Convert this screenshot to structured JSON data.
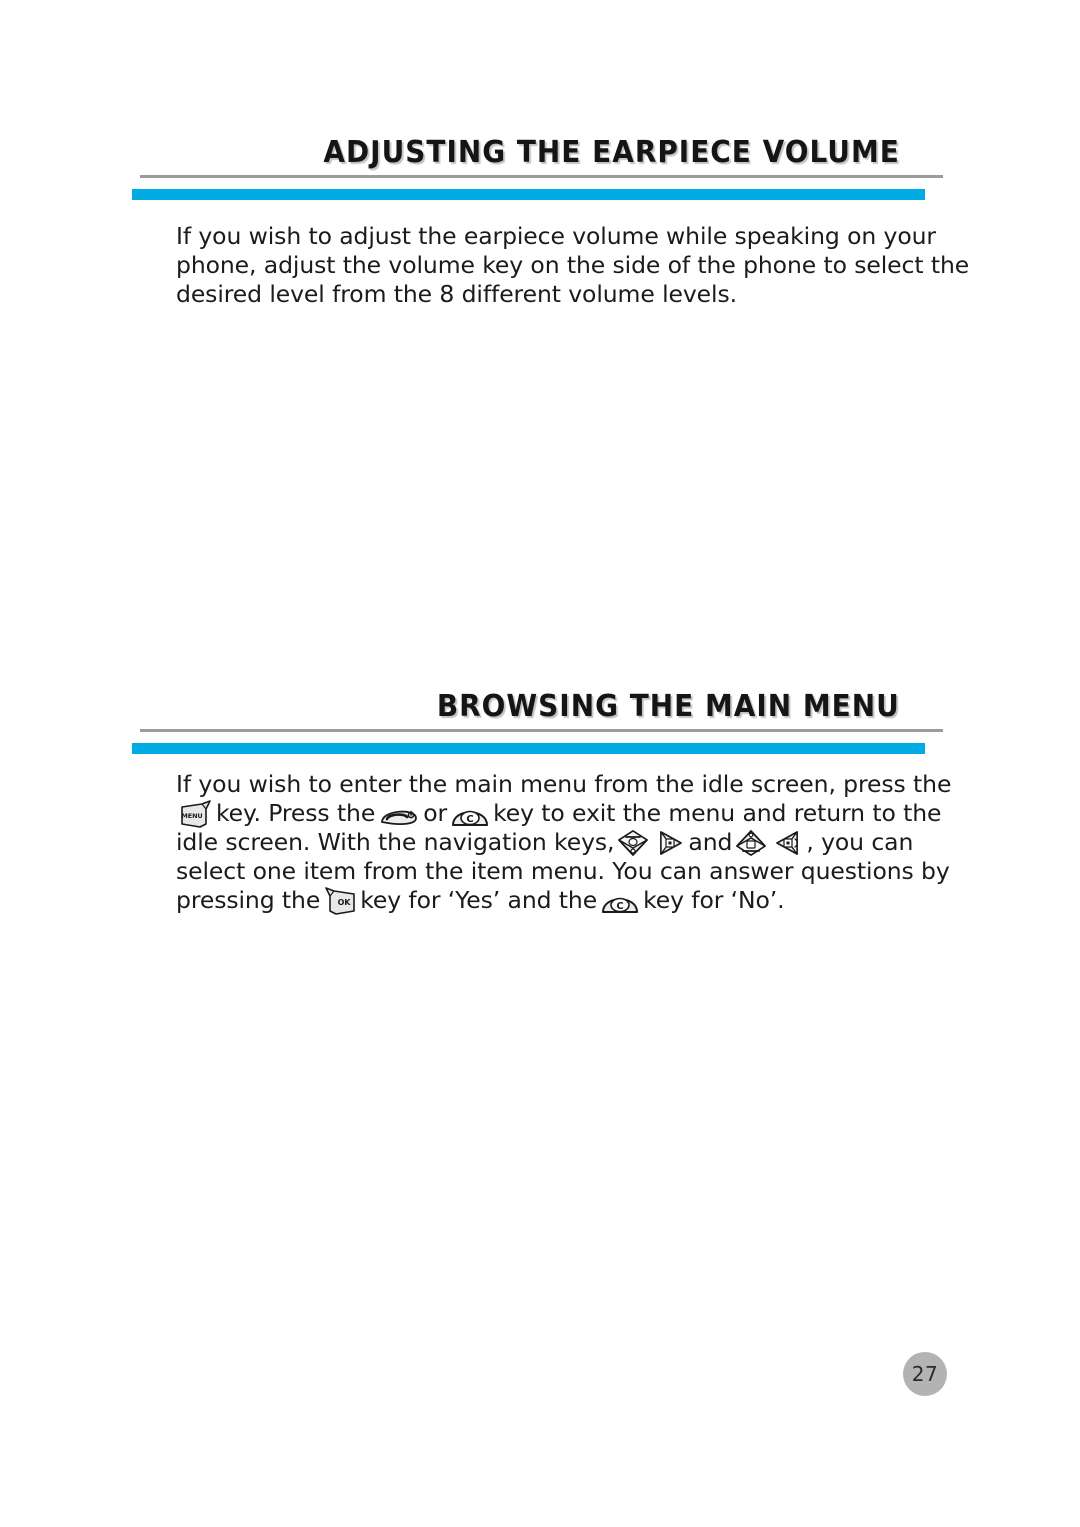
{
  "page": {
    "number": "27",
    "background_color": "#ffffff",
    "accent_color": "#00ace3",
    "rule_color": "#9b9b9b",
    "text_color": "#1b1b1b"
  },
  "sections": [
    {
      "id": "adjusting-earpiece-volume",
      "title": "ADJUSTING THE EARPIECE VOLUME",
      "lines": [
        "If you wish to adjust the earpiece volume while speaking on your",
        "phone, adjust the volume key on the side of the phone to select the",
        "desired level from the 8 different volume levels."
      ]
    },
    {
      "id": "browsing-main-menu",
      "title": "BROWSING THE MAIN MENU",
      "lines": {
        "l1": "If you wish to enter the main menu from the idle screen, press the",
        "l2a": "key. Press the",
        "l2b": "or",
        "l2c": "key to exit the menu and return to the",
        "l3a": "idle screen. With the navigation keys,",
        "l3b": "and",
        "l3c": ", you can",
        "l4": "select one item from the item menu. You can answer questions by",
        "l5a": "pressing the",
        "l5b": "key for ‘Yes’ and the",
        "l5c": "key for ‘No’."
      }
    }
  ],
  "key_icons": {
    "menu": {
      "name": "menu-key-icon",
      "label": "MENU"
    },
    "end_call": {
      "name": "end-call-key-icon",
      "label": ""
    },
    "clear": {
      "name": "clear-key-icon",
      "label": "C"
    },
    "nav_up": {
      "name": "nav-up-key-icon",
      "label": ""
    },
    "nav_right": {
      "name": "nav-right-key-icon",
      "label": ""
    },
    "nav_down": {
      "name": "nav-down-key-icon",
      "label": ""
    },
    "nav_left": {
      "name": "nav-left-key-icon",
      "label": ""
    },
    "ok": {
      "name": "ok-key-icon",
      "label": "OK"
    },
    "clear2": {
      "name": "clear-key-icon",
      "label": "C"
    }
  }
}
